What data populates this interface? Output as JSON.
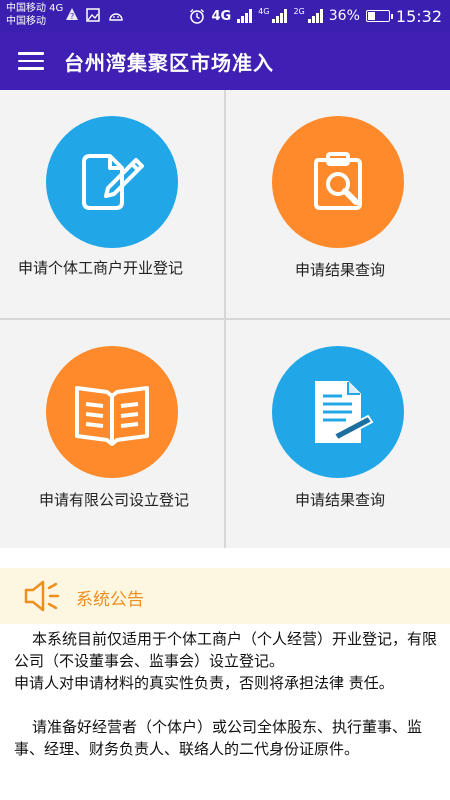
{
  "status_bar": {
    "carrier1": "中国移动 4G",
    "carrier2": "中国移动",
    "net1": "4G",
    "net2_tag": "4G",
    "net3_tag": "2G",
    "battery": "36%",
    "battery_level": 0.36,
    "time": "15:32"
  },
  "app_bar": {
    "title": "台州湾集聚区市场准入"
  },
  "tiles": [
    {
      "label": "申请个体工商户开业登记",
      "color": "#21a7e8",
      "icon": "edit-document-icon"
    },
    {
      "label": "申请结果查询",
      "color": "#ff8a2b",
      "icon": "clipboard-search-icon"
    },
    {
      "label": "申请有限公司设立登记",
      "color": "#ff8a2b",
      "icon": "open-book-icon"
    },
    {
      "label": "申请结果查询",
      "color": "#21a7e8",
      "icon": "document-pen-icon"
    }
  ],
  "notice": {
    "title": "系统公告",
    "para1": "本系统目前仅适用于个体工商户（个人经营）开业登记，有限公司（不设董事会、监事会）设立登记。",
    "para2": "申请人对申请材料的真实性负责，否则将承担法律 责任。",
    "para3": "请准备好经营者（个体户）或公司全体股东、执行董事、监事、经理、财务负责人、联络人的二代身份证原件。"
  }
}
